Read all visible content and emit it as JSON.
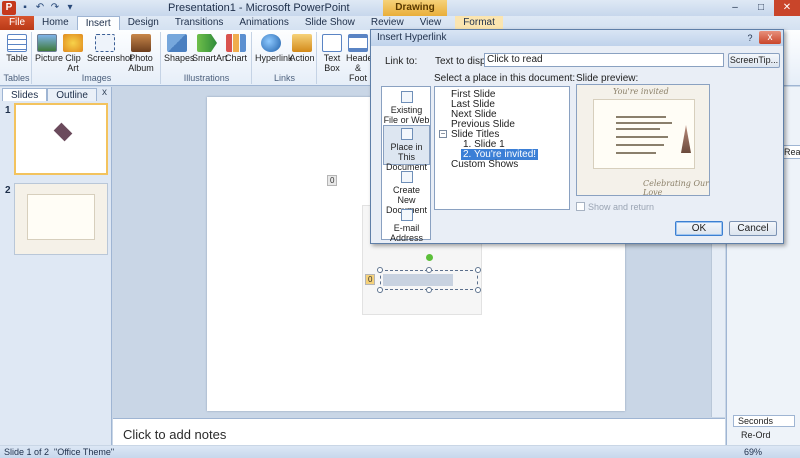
{
  "app": {
    "window_title": "Presentation1 - Microsoft PowerPoint",
    "contextual_tab": "Drawing Tools"
  },
  "ribbon": {
    "file_tab": "File",
    "tabs": [
      "Home",
      "Insert",
      "Design",
      "Transitions",
      "Animations",
      "Slide Show",
      "Review",
      "View",
      "Format"
    ],
    "active_tab": "Insert",
    "groups": {
      "tables": {
        "label": "Tables",
        "buttons": [
          "Table"
        ]
      },
      "images": {
        "label": "Images",
        "buttons": [
          "Picture",
          "Clip Art",
          "Screenshot",
          "Photo Album"
        ]
      },
      "illustrations": {
        "label": "Illustrations",
        "buttons": [
          "Shapes",
          "SmartArt",
          "Chart"
        ]
      },
      "links": {
        "label": "Links",
        "buttons": [
          "Hyperlink",
          "Action"
        ]
      },
      "text": {
        "buttons": [
          "Text Box",
          "Header & Foot"
        ]
      }
    }
  },
  "left_pane": {
    "tabs": [
      "Slides",
      "Outline"
    ],
    "close": "x",
    "slides": [
      "1",
      "2"
    ]
  },
  "notes": {
    "placeholder": "Click to add notes"
  },
  "slide": {
    "badge": "0",
    "text_badge": "0"
  },
  "dialog": {
    "title": "Insert Hyperlink",
    "help": "?",
    "close": "x",
    "link_to_label": "Link to:",
    "text_to_display_label": "Text to display:",
    "text_to_display_value": "Click to read",
    "screentip_button": "ScreenTip...",
    "link_to_options": [
      {
        "label": "Existing File or Web Page",
        "icon": "globe-file-icon"
      },
      {
        "label": "Place in This Document",
        "icon": "document-place-icon"
      },
      {
        "label": "Create New Document",
        "icon": "new-document-icon"
      },
      {
        "label": "E-mail Address",
        "icon": "email-icon"
      }
    ],
    "active_link_to": "Place in This Document",
    "select_place_label": "Select a place in this document:",
    "tree": {
      "first": "First Slide",
      "last": "Last Slide",
      "next": "Next Slide",
      "previous": "Previous Slide",
      "titles_header": "Slide Titles",
      "titles": [
        "1. Slide 1",
        "2.  You're invited!"
      ],
      "selected": "2.  You're invited!",
      "custom": "Custom Shows"
    },
    "preview_label": "Slide preview:",
    "preview_script_top": "You're invited",
    "preview_script_bottom": "Celebrating Our Love",
    "show_and_return": "Show and return",
    "ok": "OK",
    "cancel": "Cancel"
  },
  "right_pane": {
    "read_label": "Read",
    "seconds_label": "Seconds",
    "reorder_label": "Re-Ord"
  },
  "status": {
    "slide_of": "Slide 1 of 2",
    "theme": "\"Office Theme\"",
    "zoom": "69%"
  },
  "colors": {
    "accent": "#3b7fd6",
    "file_tab": "#c5391d",
    "drawing_tools": "#e9ae3a"
  }
}
